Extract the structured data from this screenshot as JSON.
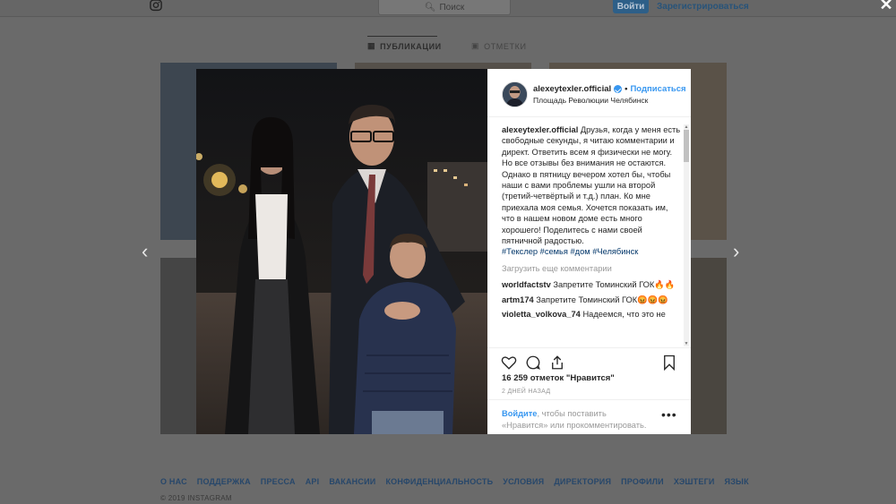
{
  "header": {
    "search_placeholder": "Поиск",
    "login_label": "Войти",
    "register_label": "Зарегистрироваться"
  },
  "tabs": [
    {
      "label": "ПУБЛИКАЦИИ",
      "active": true
    },
    {
      "label": "ОТМЕТКИ",
      "active": false
    }
  ],
  "post": {
    "username": "alexeytexler.official",
    "follow_label": "Подписаться",
    "location": "Площадь Революции Челябинск",
    "caption_author": "alexeytexler.official",
    "caption_text": "Друзья, когда у меня есть свободные секунды, я читаю комментарии и директ. Ответить всем я физически не могу. Но все отзывы без внимания не остаются.",
    "caption_text_2": "Однако в пятницу вечером хотел бы, чтобы наши с вами проблемы ушли на второй (третий-четвёртый и т.д.) план. Ко мне приехала моя семья. Хочется показать им, что в нашем новом доме есть много хорошего! Поделитесь с нами своей пятничной радостью.",
    "hashtags": "#Текслер #семья #дом #Челябинск",
    "load_more": "Загрузить еще комментарии",
    "comments": [
      {
        "user": "worldfactstv",
        "text": "Запретите Томинский ГОК🔥🔥"
      },
      {
        "user": "artm174",
        "text": "Запретите Томинский ГОК😡😡😡"
      },
      {
        "user": "violetta_volkova_74",
        "text": "Надеемся, что это не"
      }
    ],
    "likes": "16 259 отметок \"Нравится\"",
    "time_ago": "2 ДНЕЙ НАЗАД",
    "login_link": "Войдите",
    "login_text": ", чтобы поставить «Нравится» или прокомментировать.",
    "more_icon": "•••"
  },
  "footer": {
    "links": [
      "О НАС",
      "ПОДДЕРЖКА",
      "ПРЕССА",
      "API",
      "ВАКАНСИИ",
      "КОНФИДЕНЦИАЛЬНОСТЬ",
      "УСЛОВИЯ",
      "ДИРЕКТОРИЯ",
      "ПРОФИЛИ",
      "ХЭШТЕГИ",
      "ЯЗЫК"
    ],
    "copyright": "© 2019 INSTAGRAM"
  },
  "icons": {
    "close": "✕",
    "prev": "‹",
    "next": "›"
  },
  "colors": {
    "accent": "#3897f0",
    "overlay": "#6a6a6a"
  }
}
